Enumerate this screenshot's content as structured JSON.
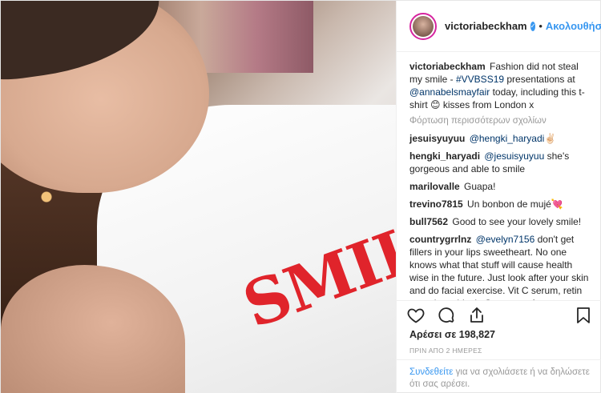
{
  "post": {
    "username": "victoriabeckham",
    "follow_label": "Ακολουθήστε",
    "photo_shirt_text": "SMIL",
    "caption": {
      "username": "victoriabeckham",
      "text1": " Fashion did not steal my smile - ",
      "hashtag": "#VVBSS19",
      "text2": " presentations at ",
      "mention": "@annabelsmayfair",
      "text3": " today, including this t-shirt 😊 kisses from London x"
    },
    "load_more": "Φόρτωση περισσότερων σχολίων",
    "comments": [
      {
        "user": "jesuisyuyuu",
        "mention": "@hengki_haryadi",
        "text": "✌🏻"
      },
      {
        "user": "hengki_haryadi",
        "mention": "@jesuisyuyuu",
        "text": " she's gorgeous and able to smile"
      },
      {
        "user": "marilovalle",
        "mention": "",
        "text": "Guapa!"
      },
      {
        "user": "trevino7815",
        "mention": "",
        "text": "Un bonbon de mujé💘"
      },
      {
        "user": "bull7562",
        "mention": "",
        "text": "Good to see your lovely smile!"
      },
      {
        "user": "countrygrrlnz",
        "mention": "@evelyn7156",
        "text": " don't get fillers in your lips sweetheart. No one knows what that stuff will cause health wise in the future. Just look after your skin and do facial exercise. Vit C serum, retin a, and sun block. Stay away from surgery and junk stuff like Botox or fillers."
      }
    ],
    "likes": "Αρέσει σε 198,827",
    "timestamp": "ΠΡΙΝ ΑΠΟ 2 ΗΜΕΡΕΣ",
    "footer": {
      "login_link": "Συνδεθείτε",
      "login_text": " για να σχολιάσετε ή να δηλώσετε ότι σας αρέσει."
    }
  },
  "colors": {
    "accent": "#3897f0",
    "shirt_text": "#e0242b",
    "border": "#efefef"
  },
  "icons": [
    "heart-icon",
    "comment-icon",
    "share-icon",
    "bookmark-icon",
    "verified-badge-icon"
  ]
}
